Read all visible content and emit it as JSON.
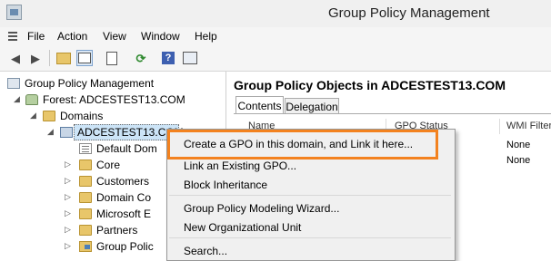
{
  "window": {
    "title": "Group Policy Management"
  },
  "menu": [
    "File",
    "Action",
    "View",
    "Window",
    "Help"
  ],
  "toolbar": {
    "icons": [
      "back-icon",
      "forward-icon",
      "up-folder-icon",
      "show-hide-tree-icon",
      "properties-icon",
      "refresh-icon",
      "help-icon",
      "console-icon"
    ]
  },
  "tree": {
    "root": "Group Policy Management",
    "forest": "Forest: ADCESTEST13.COM",
    "domains": "Domains",
    "domain": "ADCESTEST13.COM",
    "children": [
      "Default Dom",
      "Core",
      "Customers",
      "Domain Co",
      "Microsoft E",
      "Partners",
      "Group Polic"
    ]
  },
  "right": {
    "title": "Group Policy Objects in ADCESTEST13.COM",
    "tabs": [
      "Contents",
      "Delegation"
    ],
    "columns": [
      "Name",
      "GPO Status",
      "WMI Filter"
    ],
    "rows": [
      {
        "wmi": "None"
      },
      {
        "wmi": "None"
      }
    ]
  },
  "context_menu": {
    "items": [
      "Create a GPO in this domain, and Link it here...",
      "Link an Existing GPO...",
      "Block Inheritance",
      "Group Policy Modeling Wizard...",
      "New Organizational Unit",
      "Search..."
    ]
  },
  "colors": {
    "highlight": "#f3821f",
    "selection": "#cce4f7"
  }
}
